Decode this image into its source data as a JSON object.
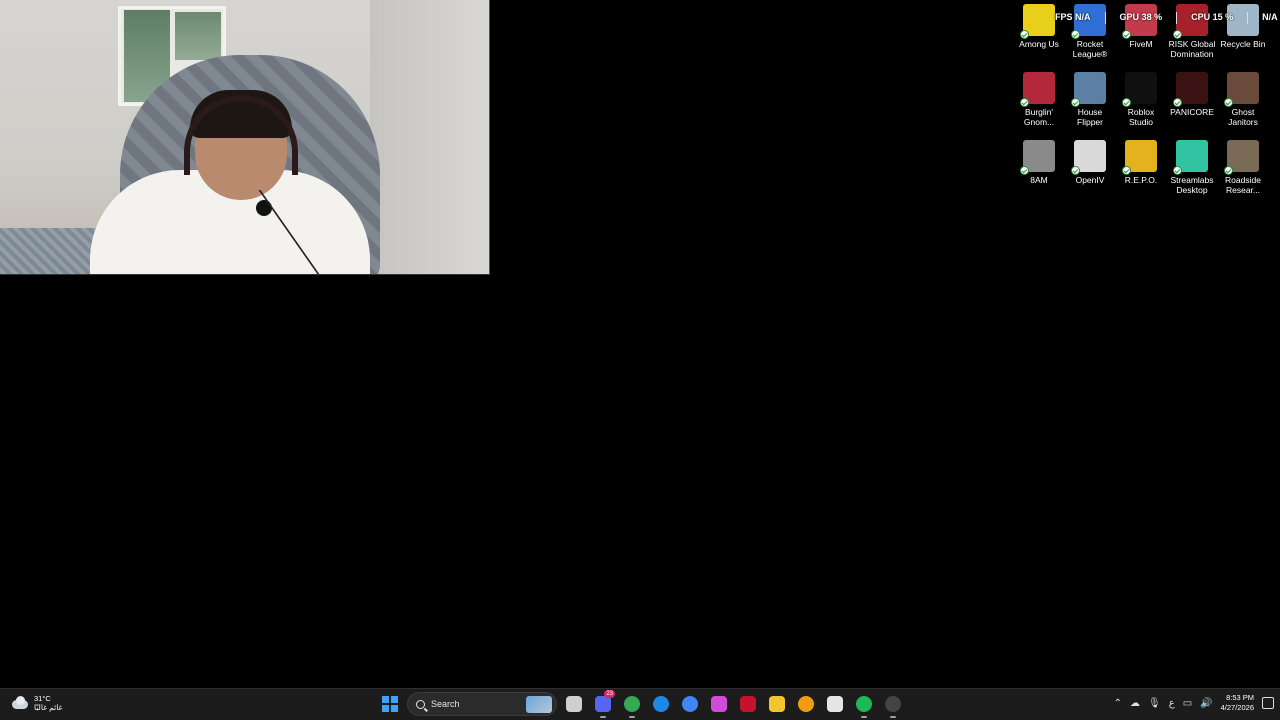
{
  "perf_overlay": {
    "fps_label": "FPS",
    "fps_value": "N/A",
    "gpu_label": "GPU",
    "gpu_value": "38 %",
    "cpu_label": "CPU",
    "cpu_value": "15 %",
    "extra_value": "N/A"
  },
  "desktop_icons": [
    {
      "label": "Among Us",
      "color": "#e8d01a"
    },
    {
      "label": "Rocket League®",
      "color": "#2f6fd6"
    },
    {
      "label": "FiveM",
      "color": "#c23a4b"
    },
    {
      "label": "RISK Global Domination",
      "color": "#a8202a"
    },
    {
      "label": "Recycle Bin",
      "color": "#9fb6c9"
    },
    {
      "label": "Burglin' Gnom...",
      "color": "#b3283a"
    },
    {
      "label": "House Flipper",
      "color": "#5c7fa6"
    },
    {
      "label": "Roblox Studio",
      "color": "#101010"
    },
    {
      "label": "PANICORE",
      "color": "#3a1214"
    },
    {
      "label": "Ghost Janitors",
      "color": "#6a4a3a"
    },
    {
      "label": "8AM",
      "color": "#8a8a8a"
    },
    {
      "label": "OpenIV",
      "color": "#d9d9d9"
    },
    {
      "label": "R.E.P.O.",
      "color": "#e3b21c"
    },
    {
      "label": "Streamlabs Desktop",
      "color": "#31c3a2"
    },
    {
      "label": "Roadside Resear...",
      "color": "#7a6a55"
    }
  ],
  "taskbar": {
    "weather": {
      "temp": "31°C",
      "condition": "غائم غالبًا"
    },
    "search_label": "Search",
    "apps": [
      {
        "name": "file-explorer-tasks",
        "color": "#cfcfcf"
      },
      {
        "name": "discord",
        "color": "#5865f2",
        "badge": "23"
      },
      {
        "name": "chrome",
        "color": "#34a853"
      },
      {
        "name": "edge",
        "color": "#1e88e5"
      },
      {
        "name": "chrome-profile",
        "color": "#4285f4"
      },
      {
        "name": "copilot",
        "color": "#d24bd8"
      },
      {
        "name": "adobe-acrobat",
        "color": "#c4122f"
      },
      {
        "name": "folder",
        "color": "#f4c430"
      },
      {
        "name": "brave-shield",
        "color": "#f39c12"
      },
      {
        "name": "microsoft-store",
        "color": "#e5e5e5"
      },
      {
        "name": "spotify",
        "color": "#1db954"
      },
      {
        "name": "obs-studio",
        "color": "#444444"
      }
    ],
    "tray": {
      "lang": "ع",
      "time": "8:53 PM",
      "date": "4/27/2026"
    }
  }
}
